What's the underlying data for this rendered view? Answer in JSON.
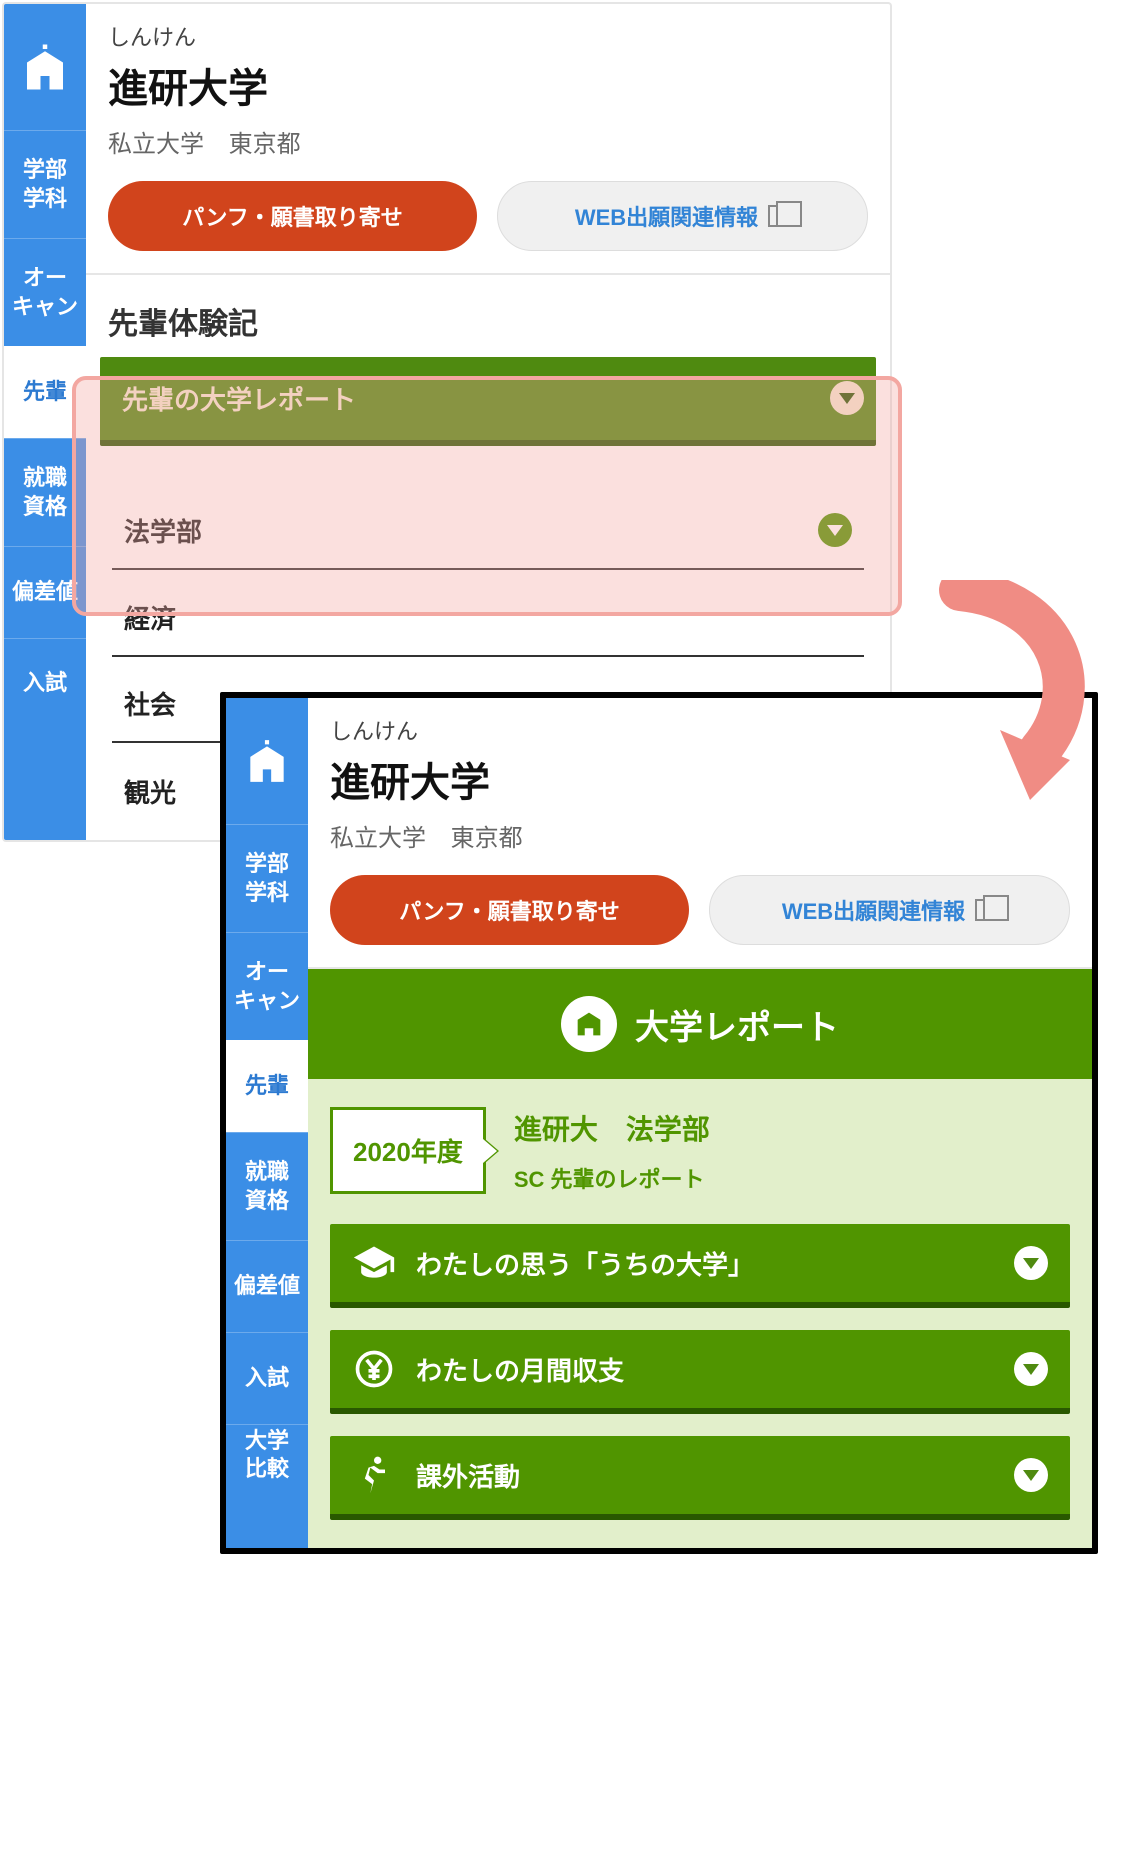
{
  "top": {
    "header": {
      "furigana": "しんけん",
      "name": "進研大学",
      "type": "私立大学",
      "location": "東京都",
      "btn_primary": "パンフ・願書取り寄せ",
      "btn_secondary": "WEB出願関連情報"
    },
    "sidebar": [
      "学部\n学科",
      "オー\nキャン",
      "先輩",
      "就職\n資格",
      "偏差値",
      "入試"
    ],
    "sidebar_active_index": 2,
    "section_title": "先輩体験記",
    "rows": {
      "dropdown": "先輩の大学レポート",
      "faculty": "法学部",
      "faculties_cut": [
        "経済",
        "社会",
        "観光"
      ]
    }
  },
  "bottom": {
    "header": {
      "furigana": "しんけん",
      "name": "進研大学",
      "type": "私立大学",
      "location": "東京都",
      "btn_primary": "パンフ・願書取り寄せ",
      "btn_secondary": "WEB出願関連情報"
    },
    "sidebar": [
      "学部\n学科",
      "オー\nキャン",
      "先輩",
      "就職\n資格",
      "偏差値",
      "入試",
      "大学\n比較"
    ],
    "sidebar_active_index": 2,
    "report_header": "大学レポート",
    "year": "2020年度",
    "report_title": "進研大　法学部",
    "report_sub": "SC 先輩のレポート",
    "accordion": [
      "わたしの思う「うちの大学」",
      "わたしの月間収支",
      "課外活動"
    ]
  }
}
